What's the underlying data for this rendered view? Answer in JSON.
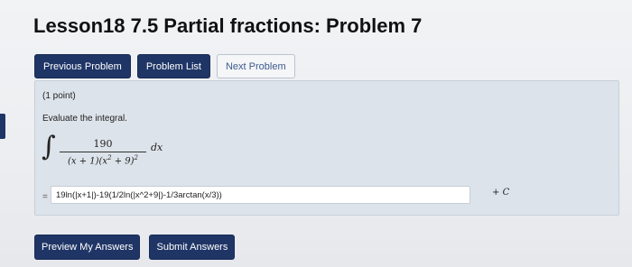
{
  "page": {
    "title": "Lesson18 7.5 Partial fractions: Problem 7"
  },
  "nav": {
    "previous": "Previous Problem",
    "list": "Problem List",
    "next": "Next Problem"
  },
  "problem": {
    "points": "(1 point)",
    "prompt": "Evaluate the integral.",
    "integral": {
      "sign": "∫",
      "numerator": "190",
      "denominator_base": "(x + 1)(x",
      "exp1": "2",
      "denominator_mid": " + 9)",
      "exp2": "2",
      "differential": "dx"
    },
    "answer": {
      "equals": "=",
      "value": "19ln(|x+1|)-19(1/2ln(|x^2+9|)-1/3arctan(x/3))",
      "plus": "+ ",
      "constant": "C"
    }
  },
  "actions": {
    "preview": "Preview My Answers",
    "submit": "Submit Answers"
  }
}
